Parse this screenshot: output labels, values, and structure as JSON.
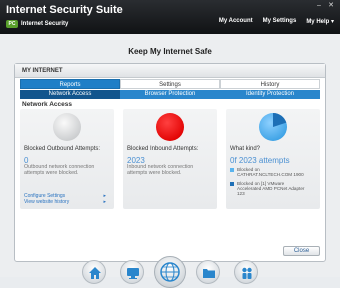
{
  "app": {
    "title": "Internet Security Suite",
    "subtitle": "Internet Security",
    "logo_text": "PC"
  },
  "top_nav": {
    "my_account": "My Account",
    "my_settings": "My Settings",
    "my_help": "My Help ▾"
  },
  "window_controls": {
    "minimize": "–",
    "close": "✕"
  },
  "heading": "Keep My Internet Safe",
  "panel": {
    "title": "MY INTERNET",
    "tabs": [
      {
        "label": "Reports",
        "active": true
      },
      {
        "label": "Settings",
        "active": false
      },
      {
        "label": "History",
        "active": false
      }
    ],
    "subtabs": [
      {
        "label": "Network Access",
        "active": true
      },
      {
        "label": "Browser Protection",
        "active": false
      },
      {
        "label": "Identity Protection",
        "active": false
      }
    ],
    "section_title": "Network Access",
    "cards": {
      "outbound": {
        "label": "Blocked Outbound Attempts:",
        "value": "0",
        "description": "Outbound network connection attempts were blocked.",
        "circle_color": "#d8dadc",
        "links": [
          "Configure Settings",
          "View website history"
        ]
      },
      "inbound": {
        "label": "Blocked Inbound Attempts:",
        "value": "2023",
        "description": "Inbound network connection attempts were blocked.",
        "circle_color": "#ff1a1a"
      },
      "kind": {
        "label": "What kind?",
        "value": "0f 2023 attempts",
        "pie_colors": {
          "main": "#5ab4ee",
          "slice": "#1d6fb6"
        },
        "legend": [
          {
            "text": "Blocked on CATHRAT.NCLTECH.COM 1900",
            "color": "#5ab4ee"
          },
          {
            "text": "Blocked on [1] VMware Accelerated AMD PCNet Adapter 123",
            "color": "#1d6fb6"
          }
        ]
      }
    },
    "close_label": "Close"
  },
  "dock": [
    {
      "icon": "home-icon"
    },
    {
      "icon": "monitor-icon"
    },
    {
      "icon": "globe-icon"
    },
    {
      "icon": "folder-icon"
    },
    {
      "icon": "users-icon"
    }
  ],
  "colors": {
    "accent": "#1f7fc7",
    "accent_dark": "#12558d",
    "alert": "#ff1a1a"
  }
}
